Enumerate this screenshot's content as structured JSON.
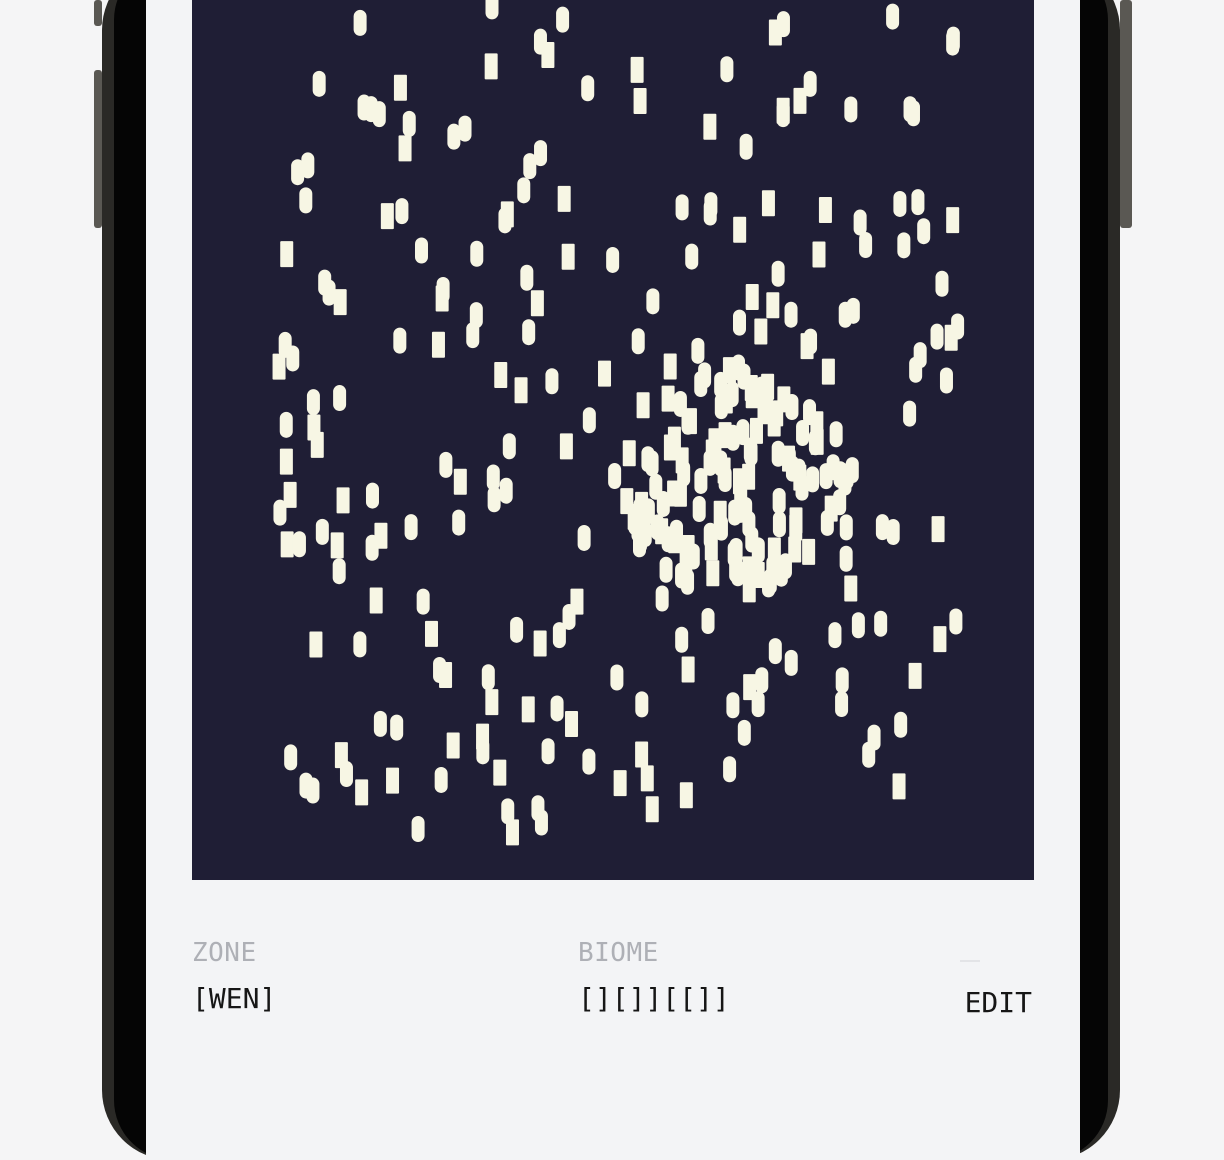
{
  "zone": {
    "label": "ZONE",
    "value": "[WEN]"
  },
  "biome": {
    "label": "BIOME",
    "value": "[][]][[]]"
  },
  "actions": {
    "edit_label": "EDIT"
  },
  "colors": {
    "art_background": "#1f1e35",
    "glyph": "#f7f6e4",
    "screen": "#f3f4f6"
  }
}
